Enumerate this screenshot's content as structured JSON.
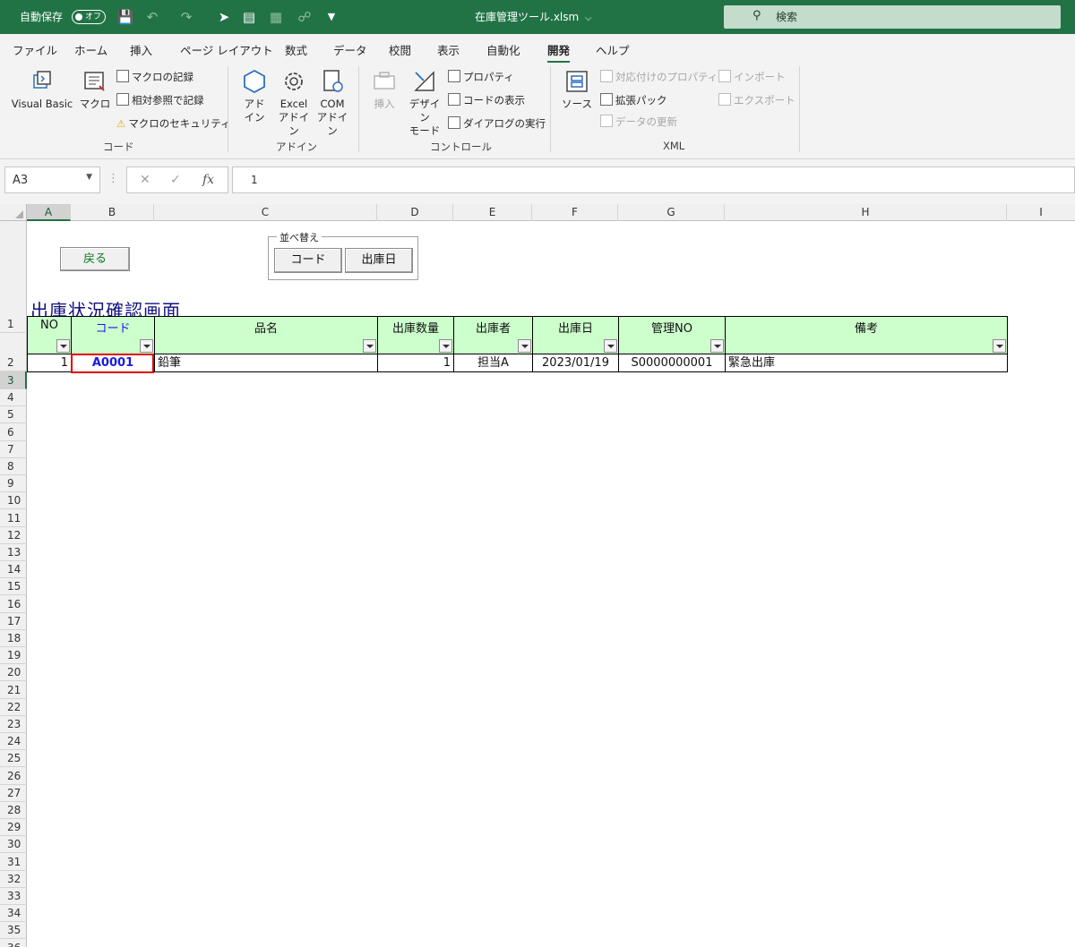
{
  "titlebar": {
    "autosave_label": "自動保存",
    "autosave_state": "オフ",
    "file_title": "在庫管理ツール.xlsm",
    "search_placeholder": "検索"
  },
  "ribbon_tabs": [
    "ファイル",
    "ホーム",
    "挿入",
    "ページ レイアウト",
    "数式",
    "データ",
    "校閲",
    "表示",
    "自動化",
    "開発",
    "ヘルプ"
  ],
  "active_tab_index": 9,
  "ribbon": {
    "code_group": {
      "label": "コード",
      "visual_basic": "Visual Basic",
      "macro": "マクロ",
      "record_macro": "マクロの記録",
      "relative_ref": "相対参照で記録",
      "macro_security": "マクロのセキュリティ"
    },
    "addin_group": {
      "label": "アドイン",
      "addin_l1": "アド",
      "addin_l2": "イン",
      "excel_addin_l1": "Excel",
      "excel_addin_l2": "アドイン",
      "com_addin_l1": "COM",
      "com_addin_l2": "アドイン"
    },
    "control_group": {
      "label": "コントロール",
      "insert": "挿入",
      "design_l1": "デザイン",
      "design_l2": "モード",
      "properties": "プロパティ",
      "view_code": "コードの表示",
      "run_dialog": "ダイアログの実行"
    },
    "xml_group": {
      "label": "XML",
      "source": "ソース",
      "map_properties": "対応付けのプロパティ",
      "expansion_pack": "拡張パック",
      "refresh_data": "データの更新",
      "import": "インポート",
      "export": "エクスポート"
    }
  },
  "formula_bar": {
    "name_box": "A3",
    "formula": "1"
  },
  "columns": [
    "A",
    "B",
    "C",
    "D",
    "E",
    "F",
    "G",
    "H",
    "I"
  ],
  "rows": [
    "1",
    "2",
    "3",
    "4",
    "5",
    "6",
    "7",
    "8",
    "9",
    "10",
    "11",
    "12",
    "13",
    "14",
    "15",
    "16",
    "17",
    "18",
    "19",
    "20",
    "21",
    "22",
    "23",
    "24",
    "25",
    "26",
    "27",
    "28",
    "29",
    "30",
    "31",
    "32",
    "33",
    "34",
    "35",
    "36"
  ],
  "sheet": {
    "back_button": "戻る",
    "sort_group_label": "並べ替え",
    "sort_code_button": "コード",
    "sort_date_button": "出庫日",
    "title": "出庫状況確認画面",
    "headers": [
      "NO",
      "コード",
      "品名",
      "出庫数量",
      "出庫者",
      "出庫日",
      "管理NO",
      "備考"
    ],
    "data_rows": [
      [
        "1",
        "A0001",
        "鉛筆",
        "1",
        "担当A",
        "2023/01/19",
        "S0000000001",
        "緊急出庫"
      ]
    ]
  }
}
